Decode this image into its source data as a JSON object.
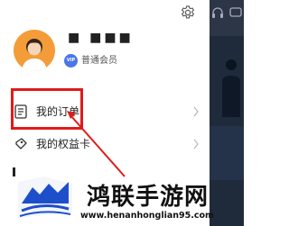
{
  "profile": {
    "username": "■ ■■■",
    "vip_badge": "VIP",
    "membership": "普通会员"
  },
  "menu": {
    "items": [
      {
        "label": "我的订单",
        "icon": "order-list-icon"
      },
      {
        "label": "我的权益卡",
        "icon": "benefit-card-icon"
      }
    ]
  },
  "watermark": {
    "title": "鸿联手游网",
    "url": "www.henanhonglian95.com"
  },
  "colors": {
    "highlight": "#e11a1a",
    "avatar": "#f39c38",
    "vip": "#4a76e8",
    "right_panel": "#1f2b3b"
  }
}
